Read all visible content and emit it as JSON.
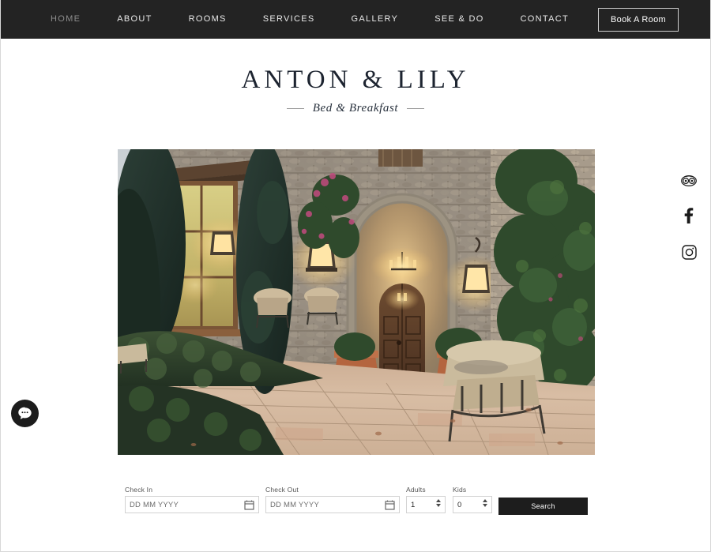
{
  "nav": {
    "items": [
      {
        "label": "HOME",
        "active": true
      },
      {
        "label": "ABOUT",
        "active": false
      },
      {
        "label": "ROOMS",
        "active": false
      },
      {
        "label": "SERVICES",
        "active": false
      },
      {
        "label": "GALLERY",
        "active": false
      },
      {
        "label": "SEE & DO",
        "active": false
      },
      {
        "label": "CONTACT",
        "active": false
      }
    ],
    "book_button": "Book A Room",
    "background_color": "#232323",
    "active_color": "#8d8d8d",
    "link_color": "#e9e9e9"
  },
  "brand": {
    "title": "ANTON & LILY",
    "subtitle": "Bed & Breakfast",
    "title_color": "#1d2430"
  },
  "hero": {
    "alt": "Mediterranean stone villa courtyard at dusk with arched wooden entry door, lit lanterns, cypress trees and terracotta brick paving"
  },
  "booking": {
    "check_in": {
      "label": "Check In",
      "placeholder": "DD MM YYYY",
      "value": ""
    },
    "check_out": {
      "label": "Check Out",
      "placeholder": "DD MM YYYY",
      "value": ""
    },
    "adults": {
      "label": "Adults",
      "value": "1"
    },
    "kids": {
      "label": "Kids",
      "value": "0"
    },
    "search_label": "Search",
    "search_color": "#1d1d1d"
  },
  "social": {
    "items": [
      {
        "name": "tripadvisor",
        "title": "TripAdvisor"
      },
      {
        "name": "facebook",
        "title": "Facebook"
      },
      {
        "name": "instagram",
        "title": "Instagram"
      }
    ]
  },
  "chat": {
    "title": "Chat"
  }
}
